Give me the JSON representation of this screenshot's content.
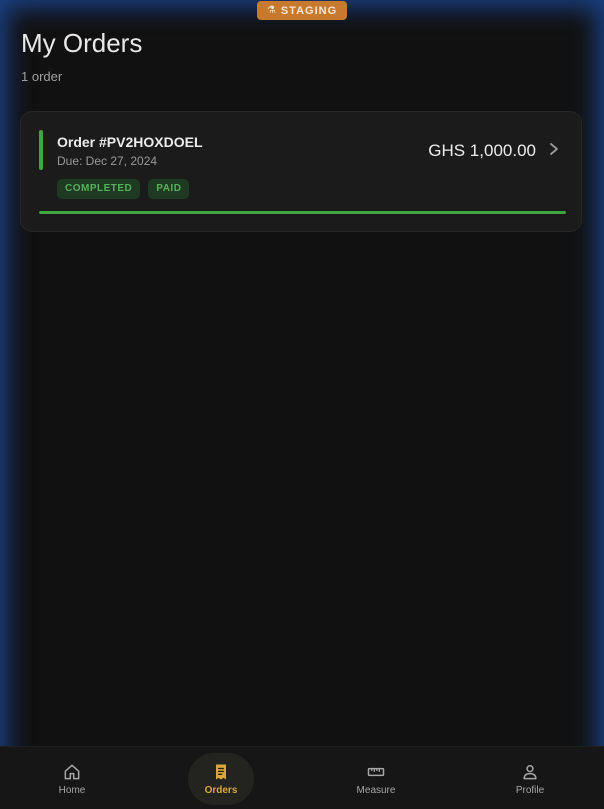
{
  "environment_badge": {
    "label": "STAGING",
    "icon": "flask-icon"
  },
  "header": {
    "title": "My Orders",
    "count": "1 order"
  },
  "orders": [
    {
      "id": "Order #PV2HOXDOEL",
      "due": "Due: Dec 27, 2024",
      "amount": "GHS 1,000.00",
      "status": "COMPLETED",
      "payment": "PAID",
      "progress": 1.0,
      "accent_color": "#3fa63f"
    }
  ],
  "nav": {
    "items": [
      {
        "label": "Home",
        "icon": "home-icon",
        "active": false
      },
      {
        "label": "Orders",
        "icon": "receipt-icon",
        "active": true
      },
      {
        "label": "Measure",
        "icon": "ruler-icon",
        "active": false
      },
      {
        "label": "Profile",
        "icon": "user-icon",
        "active": false
      }
    ]
  },
  "colors": {
    "accent": "#d9a640",
    "success": "#3fa63f",
    "staging": "#c77a2e"
  }
}
